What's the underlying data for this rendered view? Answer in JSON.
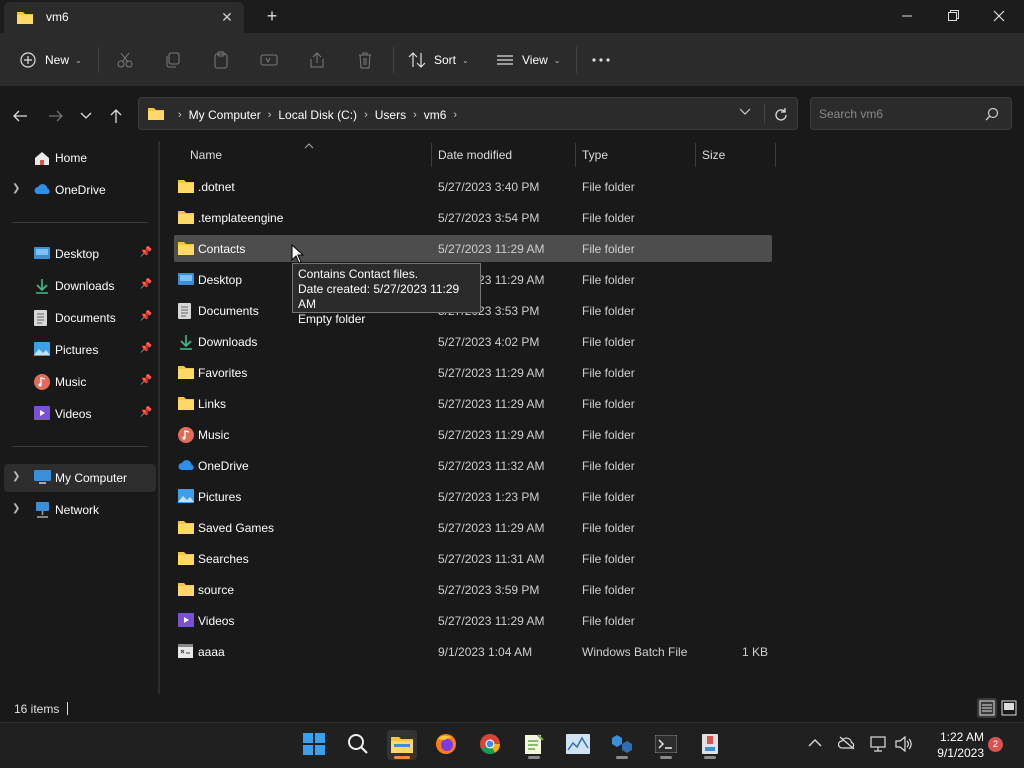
{
  "window": {
    "tab_title": "vm6",
    "minimize_icon": "minimize-icon",
    "maximize_icon": "restore-icon",
    "close_icon": "close-icon"
  },
  "toolbar": {
    "new_label": "New",
    "sort_label": "Sort",
    "view_label": "View",
    "more_label": "..."
  },
  "address": {
    "crumbs": [
      "My Computer",
      "Local Disk (C:)",
      "Users",
      "vm6"
    ]
  },
  "search": {
    "placeholder": "Search vm6"
  },
  "sidebar": {
    "home": "Home",
    "onedrive": "OneDrive",
    "quick": [
      {
        "label": "Desktop",
        "icon": "desktop-icon"
      },
      {
        "label": "Downloads",
        "icon": "downloads-icon"
      },
      {
        "label": "Documents",
        "icon": "documents-icon"
      },
      {
        "label": "Pictures",
        "icon": "pictures-icon"
      },
      {
        "label": "Music",
        "icon": "music-icon"
      },
      {
        "label": "Videos",
        "icon": "videos-icon"
      }
    ],
    "my_computer": "My Computer",
    "network": "Network"
  },
  "columns": {
    "name": "Name",
    "date": "Date modified",
    "type": "Type",
    "size": "Size"
  },
  "files": [
    {
      "name": ".dotnet",
      "date": "5/27/2023 3:40 PM",
      "type": "File folder",
      "size": "",
      "icon": "folder-icon"
    },
    {
      "name": ".templateengine",
      "date": "5/27/2023 3:54 PM",
      "type": "File folder",
      "size": "",
      "icon": "folder-icon"
    },
    {
      "name": "Contacts",
      "date": "5/27/2023 11:29 AM",
      "type": "File folder",
      "size": "",
      "icon": "folder-icon"
    },
    {
      "name": "Desktop",
      "date": "5/27/2023 11:29 AM",
      "type": "File folder",
      "size": "",
      "icon": "desktop-icon"
    },
    {
      "name": "Documents",
      "date": "5/27/2023 3:53 PM",
      "type": "File folder",
      "size": "",
      "icon": "documents-icon"
    },
    {
      "name": "Downloads",
      "date": "5/27/2023 4:02 PM",
      "type": "File folder",
      "size": "",
      "icon": "downloads-icon"
    },
    {
      "name": "Favorites",
      "date": "5/27/2023 11:29 AM",
      "type": "File folder",
      "size": "",
      "icon": "folder-icon"
    },
    {
      "name": "Links",
      "date": "5/27/2023 11:29 AM",
      "type": "File folder",
      "size": "",
      "icon": "folder-icon"
    },
    {
      "name": "Music",
      "date": "5/27/2023 11:29 AM",
      "type": "File folder",
      "size": "",
      "icon": "music-icon"
    },
    {
      "name": "OneDrive",
      "date": "5/27/2023 11:32 AM",
      "type": "File folder",
      "size": "",
      "icon": "onedrive-icon"
    },
    {
      "name": "Pictures",
      "date": "5/27/2023 1:23 PM",
      "type": "File folder",
      "size": "",
      "icon": "pictures-icon"
    },
    {
      "name": "Saved Games",
      "date": "5/27/2023 11:29 AM",
      "type": "File folder",
      "size": "",
      "icon": "folder-icon"
    },
    {
      "name": "Searches",
      "date": "5/27/2023 11:31 AM",
      "type": "File folder",
      "size": "",
      "icon": "folder-icon"
    },
    {
      "name": "source",
      "date": "5/27/2023 3:59 PM",
      "type": "File folder",
      "size": "",
      "icon": "folder-icon"
    },
    {
      "name": "Videos",
      "date": "5/27/2023 11:29 AM",
      "type": "File folder",
      "size": "",
      "icon": "videos-icon"
    },
    {
      "name": "aaaa",
      "date": "9/1/2023 1:04 AM",
      "type": "Windows Batch File",
      "size": "1 KB",
      "icon": "batch-file-icon"
    }
  ],
  "tooltip": {
    "line1": "Contains Contact files.",
    "line2": "Date created: 5/27/2023 11:29 AM",
    "line3": "Empty folder"
  },
  "status": {
    "item_count": "16 items"
  },
  "taskbar": {
    "clock_time": "1:22 AM",
    "clock_date": "9/1/2023",
    "notification_count": "2"
  },
  "colors": {
    "folder": "#f4c542",
    "accent": "#0078d4",
    "hover_row": "#4d4d4d",
    "taskbar_active": "#ff8a3d"
  }
}
